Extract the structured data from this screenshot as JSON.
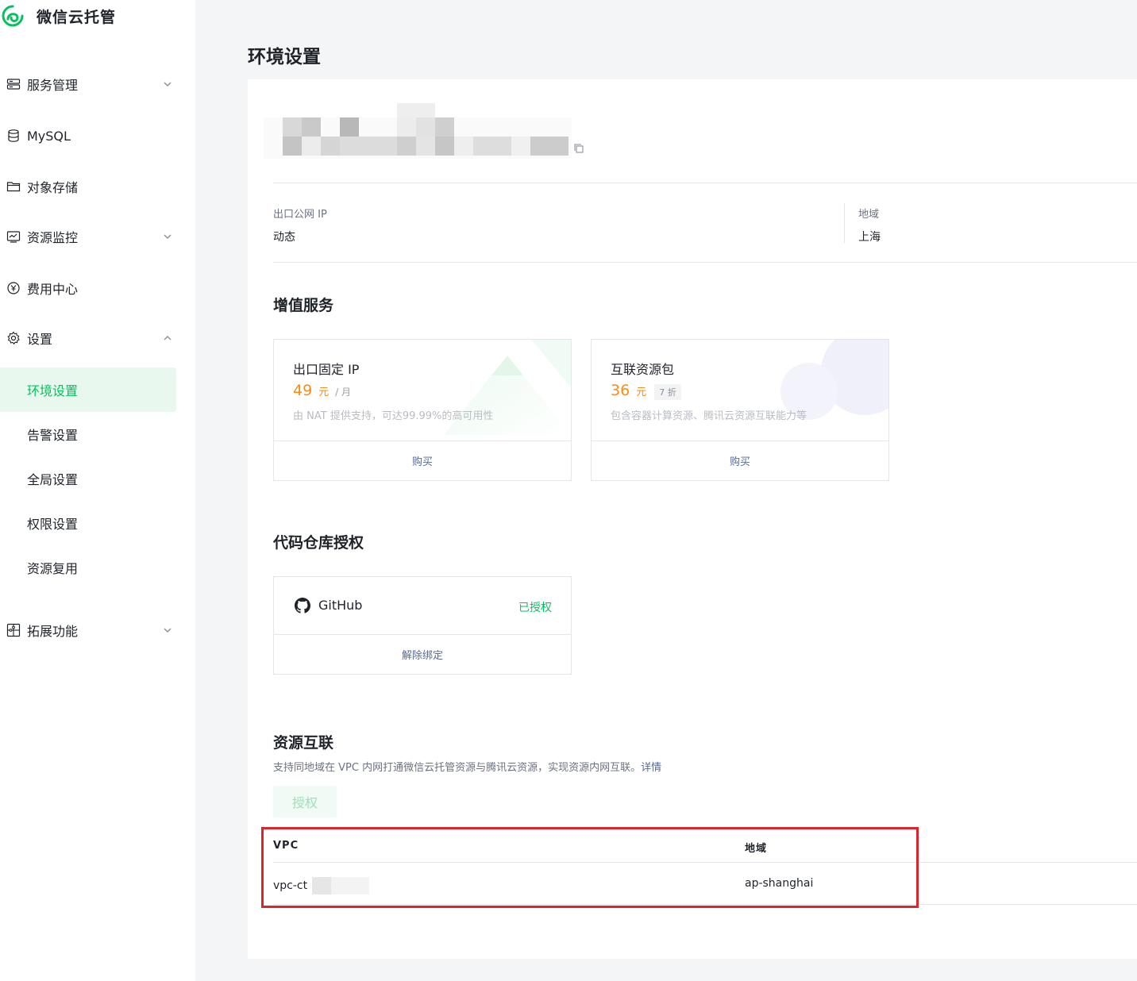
{
  "brand": {
    "name": "微信云托管",
    "color": "#07c160"
  },
  "sidebar": {
    "items": [
      {
        "label": "服务管理",
        "icon": "server-icon",
        "chevron": "down"
      },
      {
        "label": "MySQL",
        "icon": "database-icon",
        "chevron": ""
      },
      {
        "label": "对象存储",
        "icon": "folder-icon",
        "chevron": ""
      },
      {
        "label": "资源监控",
        "icon": "chart-icon",
        "chevron": "down"
      },
      {
        "label": "费用中心",
        "icon": "yen-icon",
        "chevron": ""
      },
      {
        "label": "设置",
        "icon": "gear-icon",
        "chevron": "up"
      },
      {
        "label": "拓展功能",
        "icon": "extension-icon",
        "chevron": "down"
      }
    ],
    "sub_items": [
      {
        "label": "环境设置",
        "active": true
      },
      {
        "label": "告警设置",
        "active": false
      },
      {
        "label": "全局设置",
        "active": false
      },
      {
        "label": "权限设置",
        "active": false
      },
      {
        "label": "资源复用",
        "active": false
      }
    ]
  },
  "page": {
    "title": "环境设置"
  },
  "env_info": {
    "egress_label": "出口公网 IP",
    "egress_value": "动态",
    "region_label": "地域",
    "region_value": "上海"
  },
  "value_added": {
    "title": "增值服务",
    "cards": [
      {
        "title": "出口固定 IP",
        "price": "49",
        "unit": "元",
        "per": "/ 月",
        "discount": "",
        "desc": "由 NAT 提供支持，可达99.99%的高可用性",
        "button": "购买"
      },
      {
        "title": "互联资源包",
        "price": "36",
        "unit": "元",
        "per": "",
        "discount": "7 折",
        "desc": "包含容器计算资源、腾讯云资源互联能力等",
        "button": "购买"
      }
    ]
  },
  "repo_auth": {
    "title": "代码仓库授权",
    "provider": "GitHub",
    "status": "已授权",
    "unbind": "解除绑定"
  },
  "resource_link": {
    "title": "资源互联",
    "desc": "支持同地域在 VPC 内网打通微信云托管资源与腾讯云资源，实现资源内网互联。",
    "detail_link": "详情",
    "auth_button": "授权",
    "table": {
      "headers": [
        "VPC",
        "地域"
      ],
      "rows": [
        {
          "vpc": "vpc-ct",
          "region": "ap-shanghai"
        }
      ]
    }
  },
  "colors": {
    "accent": "#07c160",
    "link": "#576b95",
    "price": "#fa8c16",
    "highlight": "#d9262b"
  }
}
